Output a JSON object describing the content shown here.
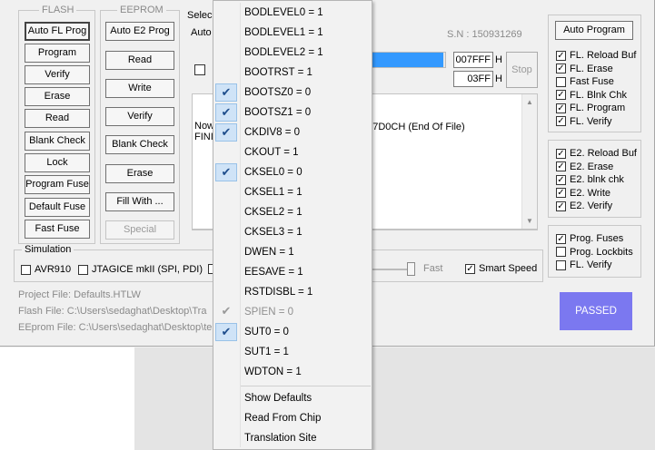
{
  "flash": {
    "title": "FLASH",
    "buttons": [
      "Auto FL Prog",
      "Program",
      "Verify",
      "Erase",
      "Read",
      "Blank Check",
      "Lock",
      "Program Fuse",
      "Default Fuse",
      "Fast Fuse"
    ]
  },
  "eeprom": {
    "title": "EEPROM",
    "buttons": [
      "Auto E2 Prog",
      "Read",
      "Write",
      "Verify",
      "Blank Check",
      "Erase",
      "Fill With ...",
      "Special"
    ]
  },
  "top": {
    "select_label": "Selec",
    "auto_label": "Auto",
    "serial": "S.N : 150931269",
    "addr1": "007FFF",
    "addr1_unit": "H",
    "addr2": "03FF",
    "addr2_unit": "H",
    "stop": "Stop",
    "progress_fraction": 0.98
  },
  "log": {
    "line1_left": "Now",
    "line1_right": "007D0CH (End Of File)",
    "line2_left": "FINI"
  },
  "right_panel": {
    "auto_program": "Auto Program",
    "group1": [
      {
        "label": "FL. Reload Buf",
        "checked": true
      },
      {
        "label": "FL. Erase",
        "checked": true
      },
      {
        "label": "Fast Fuse",
        "checked": false
      },
      {
        "label": "FL. Blnk Chk",
        "checked": true
      },
      {
        "label": "FL. Program",
        "checked": true
      },
      {
        "label": "FL. Verify",
        "checked": true
      }
    ],
    "group2": [
      {
        "label": "E2. Reload Buf",
        "checked": true
      },
      {
        "label": "E2. Erase",
        "checked": true
      },
      {
        "label": "E2. blnk chk",
        "checked": true
      },
      {
        "label": "E2. Write",
        "checked": true
      },
      {
        "label": "E2. Verify",
        "checked": true
      }
    ],
    "group3": [
      {
        "label": "Prog. Fuses",
        "checked": true
      },
      {
        "label": "Prog. Lockbits",
        "checked": false
      },
      {
        "label": "FL. Verify",
        "checked": false
      }
    ],
    "passed": "PASSED"
  },
  "simulation": {
    "title": "Simulation",
    "avr910": "AVR910",
    "jtagice": "JTAGICE mkII (SPI, PDI)",
    "fast": "Fast",
    "smart_speed": "Smart Speed"
  },
  "files": {
    "project": "Project File:   Defaults.HTLW",
    "flash": "Flash File:   C:\\Users\\sedaghat\\Desktop\\Tra",
    "eeprom": "EEprom File:   C:\\Users\\sedaghat\\Desktop\\te"
  },
  "menu": {
    "items": [
      {
        "label": "BODLEVEL0 = 1",
        "checked": false,
        "disabled": false
      },
      {
        "label": "BODLEVEL1 = 1",
        "checked": false,
        "disabled": false
      },
      {
        "label": "BODLEVEL2 = 1",
        "checked": false,
        "disabled": false
      },
      {
        "label": "BOOTRST = 1",
        "checked": false,
        "disabled": false
      },
      {
        "label": "BOOTSZ0 = 0",
        "checked": true,
        "disabled": false
      },
      {
        "label": "BOOTSZ1 = 0",
        "checked": true,
        "disabled": false
      },
      {
        "label": "CKDIV8 = 0",
        "checked": true,
        "disabled": false
      },
      {
        "label": "CKOUT = 1",
        "checked": false,
        "disabled": false
      },
      {
        "label": "CKSEL0 = 0",
        "checked": true,
        "disabled": false
      },
      {
        "label": "CKSEL1 = 1",
        "checked": false,
        "disabled": false
      },
      {
        "label": "CKSEL2 = 1",
        "checked": false,
        "disabled": false
      },
      {
        "label": "CKSEL3 = 1",
        "checked": false,
        "disabled": false
      },
      {
        "label": "DWEN = 1",
        "checked": false,
        "disabled": false
      },
      {
        "label": "EESAVE = 1",
        "checked": false,
        "disabled": false
      },
      {
        "label": "RSTDISBL = 1",
        "checked": false,
        "disabled": false
      },
      {
        "label": "SPIEN = 0",
        "checked": true,
        "disabled": true
      },
      {
        "label": "SUT0 = 0",
        "checked": true,
        "disabled": false
      },
      {
        "label": "SUT1 = 1",
        "checked": false,
        "disabled": false
      },
      {
        "label": "WDTON = 1",
        "checked": false,
        "disabled": false
      }
    ],
    "extra": [
      "Show Defaults",
      "Read From Chip",
      "Translation Site"
    ]
  },
  "colors": {
    "progress": "#3399ff",
    "passed_bg": "#7b78f0",
    "check_bg": "#cfe3f7"
  }
}
